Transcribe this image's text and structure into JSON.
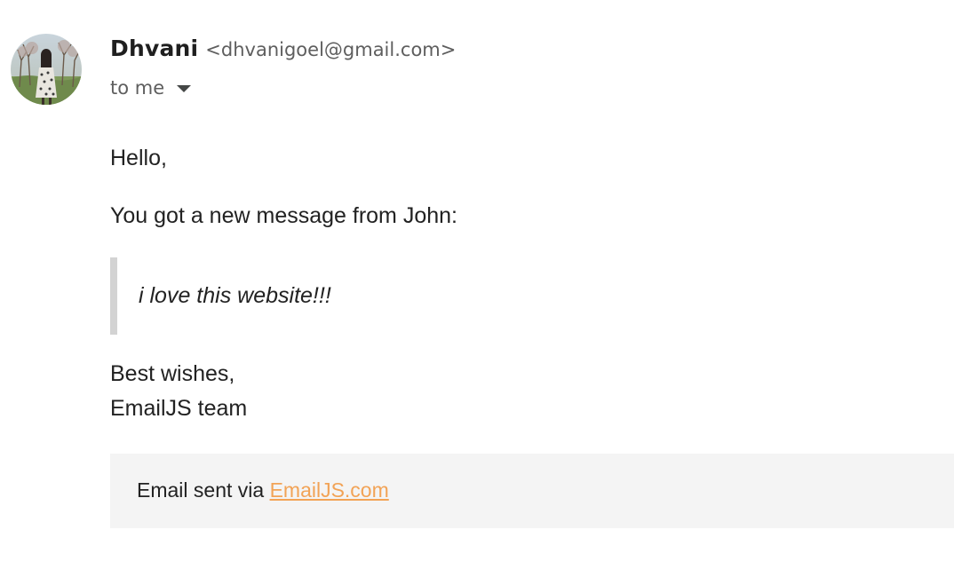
{
  "sender": {
    "name": "Dhvani",
    "email": "<dhvanigoel@gmail.com>",
    "avatar_icon": "profile-photo"
  },
  "recipient": {
    "label": "to me",
    "dropdown_icon": "caret-down-icon"
  },
  "message": {
    "greeting": "Hello,",
    "intro": "You got a new message from John:",
    "quote": "i love this website!!!",
    "closing": "Best wishes,",
    "signature": "EmailJS team"
  },
  "footer": {
    "prefix": "Email sent via ",
    "link_text": "EmailJS.com",
    "link_color": "#f2a356",
    "background": "#f4f4f4"
  }
}
